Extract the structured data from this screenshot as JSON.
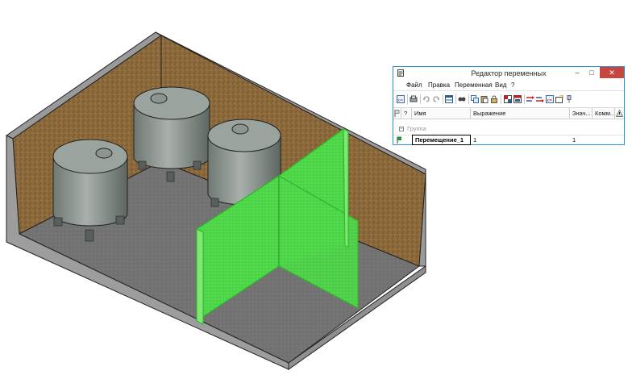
{
  "window": {
    "title": "Редактор переменных",
    "controls": {
      "minimize": "–",
      "maximize": "□",
      "close": "✕"
    }
  },
  "menu": {
    "items": [
      "Файл",
      "Правка",
      "Переменная",
      "Вид",
      "?"
    ]
  },
  "toolbar": {
    "icons": [
      "new-variable-icon",
      "print-icon",
      "undo-icon",
      "redo-icon",
      "table-view-icon",
      "find-icon",
      "copy-icon",
      "paste-icon",
      "lock-icon",
      "grid-icon",
      "filter-icon",
      "insert-row-icon",
      "insert-column-icon",
      "new-variable-table-icon",
      "export-icon",
      "pin-icon"
    ]
  },
  "grid": {
    "headers": {
      "q": "?",
      "name": "Имя",
      "expression": "Выражение",
      "value": "Знач...",
      "comment": "Комм..."
    },
    "group": {
      "label": "Группа",
      "toggle": "−"
    },
    "rows": [
      {
        "name": "Перемещение_1",
        "expression": "1",
        "value": "1",
        "comment": ""
      }
    ]
  },
  "colors": {
    "accent": "#2b8fd6",
    "close_button": "#c7463d",
    "partition_green": "#45d63a",
    "floor": "#6e6e6e",
    "soil": "#8c6a3c"
  }
}
